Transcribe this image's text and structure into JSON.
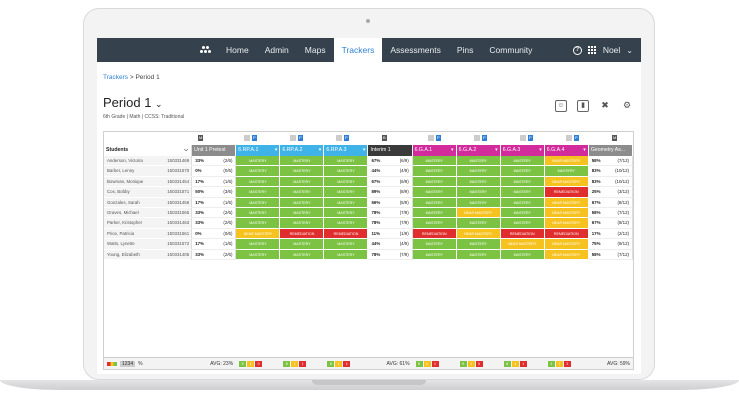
{
  "nav": {
    "items": [
      "Home",
      "Admin",
      "Maps",
      "Trackers",
      "Assessments",
      "Pins",
      "Community"
    ],
    "active": "Trackers",
    "user": "Noel"
  },
  "breadcrumb": {
    "root": "Trackers",
    "separator": ">",
    "current": "Period 1"
  },
  "page": {
    "title": "Period 1",
    "subtitle": "6th Grade | Math | CCSS: Traditional"
  },
  "grid": {
    "students_label": "Students",
    "columns": [
      {
        "label": "Unit 1 Pretest",
        "color": "#8c8c8c",
        "type": "score",
        "tag": "M"
      },
      {
        "label": "6.RP.A.1",
        "color": "#3fb3e8",
        "type": "standard",
        "tag": "P"
      },
      {
        "label": "6.RP.A.2",
        "color": "#3fb3e8",
        "type": "standard",
        "tag": "P"
      },
      {
        "label": "6.RP.A.3",
        "color": "#3fb3e8",
        "type": "standard",
        "tag": "P"
      },
      {
        "label": "Interim 1",
        "color": "#3a3a3a",
        "type": "score",
        "tag": "B"
      },
      {
        "label": "6.G.A.1",
        "color": "#d22b9c",
        "type": "standard",
        "tag": "P"
      },
      {
        "label": "6.G.A.2",
        "color": "#d22b9c",
        "type": "standard",
        "tag": "P"
      },
      {
        "label": "6.G.A.3",
        "color": "#d22b9c",
        "type": "standard",
        "tag": "P"
      },
      {
        "label": "6.G.A.4",
        "color": "#d22b9c",
        "type": "standard",
        "tag": "P"
      },
      {
        "label": "Geometry As...",
        "color": "#8c8c8c",
        "type": "score",
        "tag": "M"
      }
    ],
    "rows": [
      {
        "name": "Anderson, Victoria",
        "id": "150331469",
        "pre": [
          "33%",
          "(2/6)"
        ],
        "rp": [
          "MASTERY",
          "MASTERY",
          "MASTERY"
        ],
        "int": [
          "67%",
          "(6/9)"
        ],
        "g": [
          "MASTERY",
          "MASTERY",
          "MASTERY",
          "NEAR MASTERY"
        ],
        "geo": [
          "58%",
          "(7/12)"
        ]
      },
      {
        "name": "Barber, Lenny",
        "id": "150331570",
        "pre": [
          "0%",
          "(0/6)"
        ],
        "rp": [
          "MASTERY",
          "MASTERY",
          "MASTERY"
        ],
        "int": [
          "44%",
          "(4/9)"
        ],
        "g": [
          "MASTERY",
          "MASTERY",
          "MASTERY",
          "MASTERY"
        ],
        "geo": [
          "83%",
          "(10/12)"
        ]
      },
      {
        "name": "Bowman, Monique",
        "id": "150331454",
        "pre": [
          "17%",
          "(1/6)"
        ],
        "rp": [
          "MASTERY",
          "MASTERY",
          "MASTERY"
        ],
        "int": [
          "67%",
          "(6/9)"
        ],
        "g": [
          "MASTERY",
          "MASTERY",
          "MASTERY",
          "NEAR MASTERY"
        ],
        "geo": [
          "83%",
          "(10/12)"
        ]
      },
      {
        "name": "Cox, Bobby",
        "id": "150331571",
        "pre": [
          "50%",
          "(3/6)"
        ],
        "rp": [
          "MASTERY",
          "MASTERY",
          "MASTERY"
        ],
        "int": [
          "89%",
          "(8/9)"
        ],
        "g": [
          "MASTERY",
          "MASTERY",
          "MASTERY",
          "REMEDIATION"
        ],
        "geo": [
          "25%",
          "(3/12)"
        ]
      },
      {
        "name": "Gonzales, Sarah",
        "id": "150331456",
        "pre": [
          "17%",
          "(1/6)"
        ],
        "rp": [
          "MASTERY",
          "MASTERY",
          "MASTERY"
        ],
        "int": [
          "56%",
          "(5/9)"
        ],
        "g": [
          "MASTERY",
          "MASTERY",
          "MASTERY",
          "NEAR MASTERY"
        ],
        "geo": [
          "67%",
          "(8/12)"
        ]
      },
      {
        "name": "Graves, Michael",
        "id": "150331565",
        "pre": [
          "33%",
          "(2/6)"
        ],
        "rp": [
          "MASTERY",
          "MASTERY",
          "MASTERY"
        ],
        "int": [
          "78%",
          "(7/9)"
        ],
        "g": [
          "MASTERY",
          "NEAR MASTERY",
          "MASTERY",
          "NEAR MASTERY"
        ],
        "geo": [
          "58%",
          "(7/12)"
        ]
      },
      {
        "name": "Parker, Kristopher",
        "id": "150331463",
        "pre": [
          "33%",
          "(2/6)"
        ],
        "rp": [
          "MASTERY",
          "MASTERY",
          "MASTERY"
        ],
        "int": [
          "78%",
          "(7/9)"
        ],
        "g": [
          "MASTERY",
          "MASTERY",
          "MASTERY",
          "NEAR MASTERY"
        ],
        "geo": [
          "67%",
          "(8/12)"
        ]
      },
      {
        "name": "Price, Patricia",
        "id": "150331561",
        "pre": [
          "0%",
          "(0/6)"
        ],
        "rp": [
          "NEAR MASTERY",
          "REMEDIATION",
          "REMEDIATION"
        ],
        "int": [
          "11%",
          "(1/9)"
        ],
        "g": [
          "REMEDIATION",
          "NEAR MASTERY",
          "REMEDIATION",
          "REMEDIATION"
        ],
        "geo": [
          "17%",
          "(2/12)"
        ]
      },
      {
        "name": "Watts, Lynette",
        "id": "150331572",
        "pre": [
          "17%",
          "(1/6)"
        ],
        "rp": [
          "MASTERY",
          "MASTERY",
          "MASTERY"
        ],
        "int": [
          "44%",
          "(4/9)"
        ],
        "g": [
          "MASTERY",
          "MASTERY",
          "NEAR MASTERY",
          "NEAR MASTERY"
        ],
        "geo": [
          "75%",
          "(9/12)"
        ]
      },
      {
        "name": "Young, Elizabeth",
        "id": "150331405",
        "pre": [
          "33%",
          "(2/6)"
        ],
        "rp": [
          "MASTERY",
          "MASTERY",
          "MASTERY"
        ],
        "int": [
          "78%",
          "(7/9)"
        ],
        "g": [
          "MASTERY",
          "MASTERY",
          "MASTERY",
          "NEAR MASTERY"
        ],
        "geo": [
          "58%",
          "(7/12)"
        ]
      }
    ],
    "footer": {
      "toggle_left": "1234",
      "toggle_right": "%",
      "avg_pre": "AVG: 23%",
      "avg_interim": "AVG: 61%",
      "avg_geo": "AVG: 59%",
      "counts": [
        [
          "9",
          "1",
          "0"
        ],
        [
          "8",
          "1",
          "1"
        ],
        [
          "8",
          "1",
          "1"
        ],
        [
          "8",
          "1",
          "1"
        ],
        [
          "9",
          "1",
          "0"
        ],
        [
          "8",
          "1",
          "1"
        ],
        [
          "1",
          "7",
          "2"
        ]
      ]
    }
  },
  "colors": {
    "mastery": "#7cc243",
    "near": "#f6c21f",
    "remediation": "#e02d2d",
    "nav": "#35414c",
    "accent": "#2f7fd6"
  }
}
